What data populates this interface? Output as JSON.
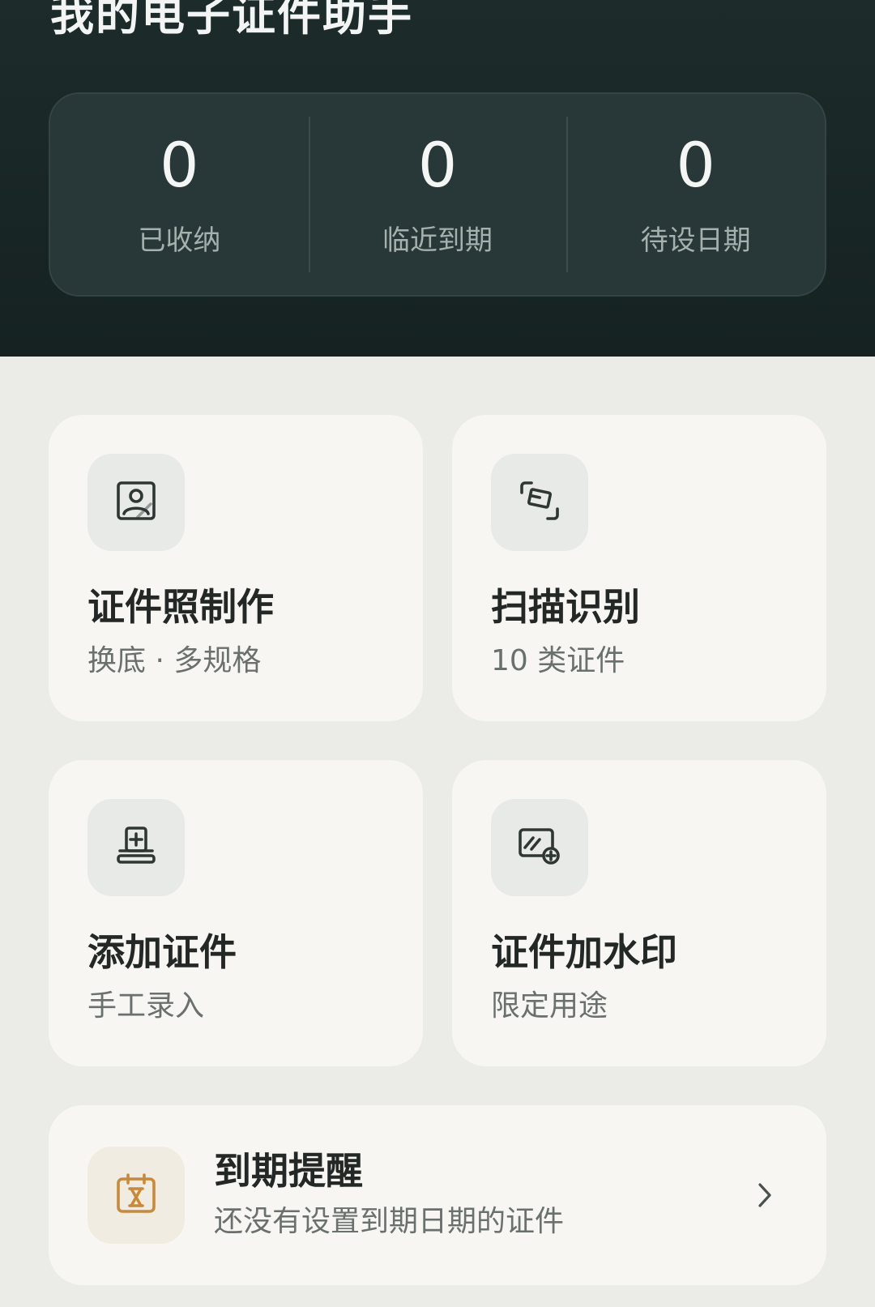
{
  "header": {
    "title": "我的电子证件助手"
  },
  "stats": [
    {
      "value": "0",
      "label": "已收纳"
    },
    {
      "value": "0",
      "label": "临近到期"
    },
    {
      "value": "0",
      "label": "待设日期"
    }
  ],
  "features": [
    {
      "icon": "portrait-photo-icon",
      "title": "证件照制作",
      "subtitle": "换底 · 多规格"
    },
    {
      "icon": "scan-card-icon",
      "title": "扫描识别",
      "subtitle": "10 类证件"
    },
    {
      "icon": "add-document-icon",
      "title": "添加证件",
      "subtitle": "手工录入"
    },
    {
      "icon": "watermark-icon",
      "title": "证件加水印",
      "subtitle": "限定用途"
    }
  ],
  "reminder": {
    "icon": "hourglass-calendar-icon",
    "title": "到期提醒",
    "subtitle": "还没有设置到期日期的证件",
    "chevron": "chevron-right-icon"
  },
  "colors": {
    "header_bg": "#1d2b2b",
    "card_bg": "#f7f6f2",
    "page_bg": "#ebebe8",
    "reminder_accent": "#c88a3a"
  }
}
